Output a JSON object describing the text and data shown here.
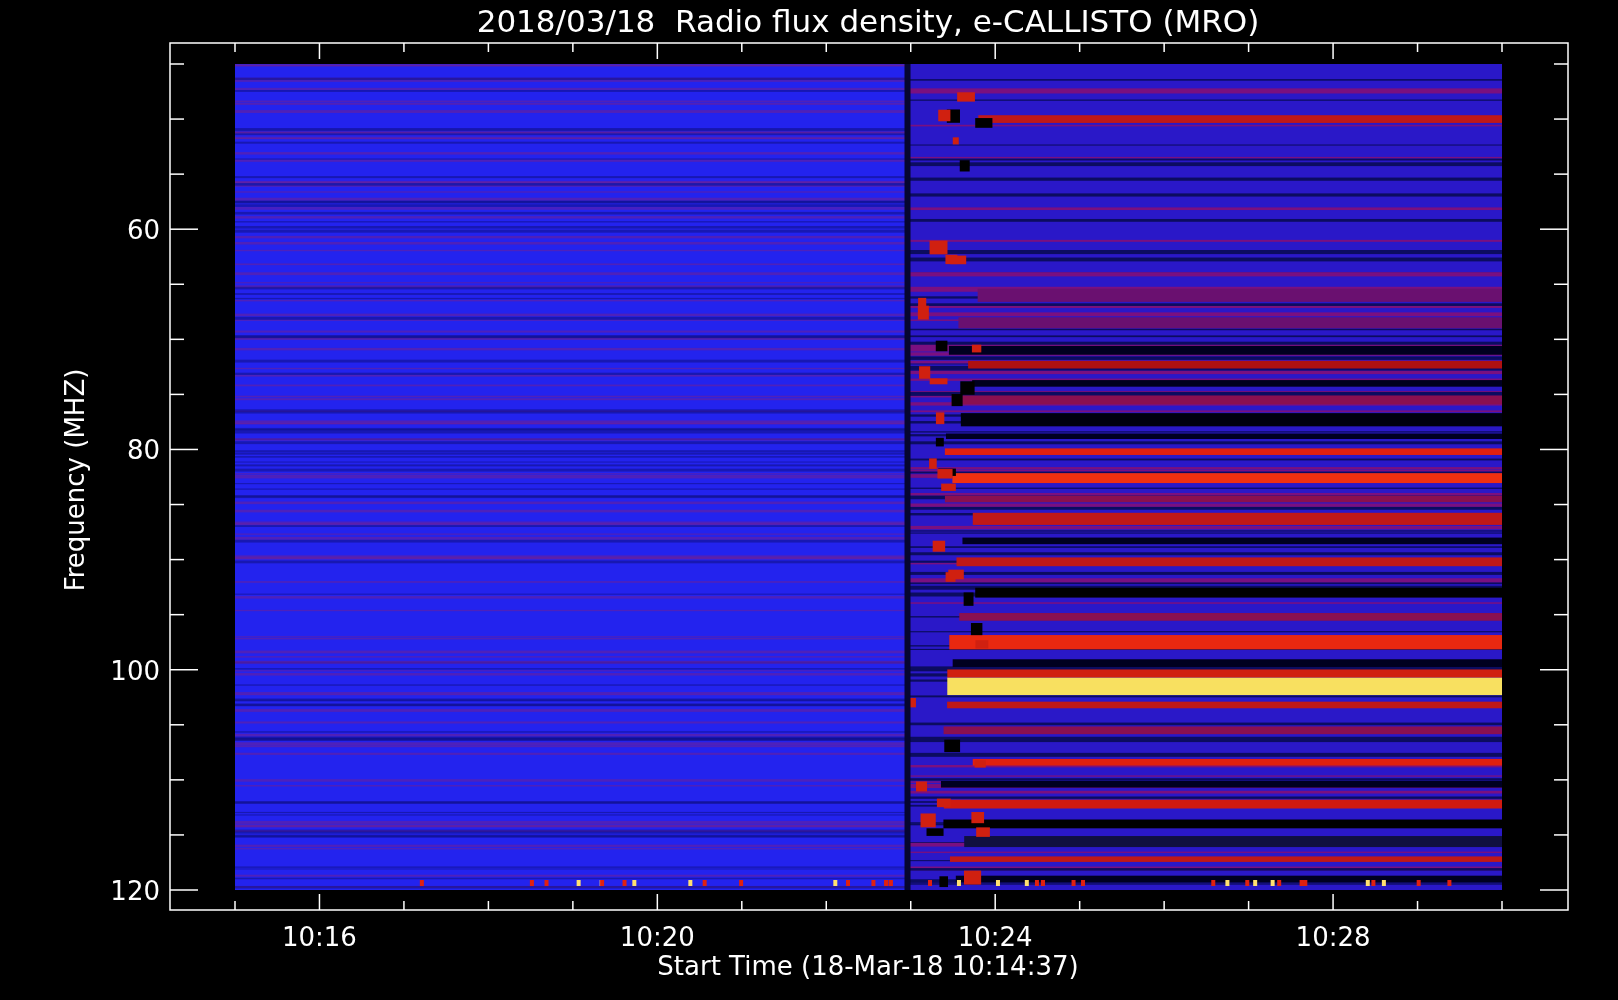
{
  "plot": {
    "title": "2018/03/18  Radio flux density, e-CALLISTO (MRO)",
    "xlabel": "Start Time (18-Mar-18 10:14:37)",
    "ylabel": "Frequency (MHZ)",
    "xticks": [
      "10:16",
      "10:20",
      "10:24",
      "10:28"
    ],
    "yticks": [
      "60",
      "80",
      "100",
      "120"
    ]
  }
}
